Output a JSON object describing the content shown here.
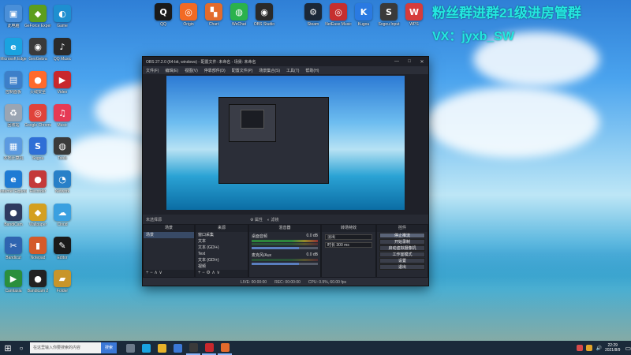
{
  "watermark": {
    "line1": "粉丝群进群21级进房管群",
    "line2": "VX：jyxb_SW"
  },
  "desktop_icons": [
    {
      "label": "此电脑",
      "icon": "computer-icon",
      "color": "#4a8fd8",
      "glyph": "▣"
    },
    {
      "label": "Microsoft Edge",
      "icon": "edge-icon",
      "color": "#1aa3e0",
      "glyph": "e"
    },
    {
      "label": "控制面板",
      "icon": "control-panel-icon",
      "color": "#3d7fc9",
      "glyph": "▤"
    },
    {
      "label": "回收站",
      "icon": "recycle-bin-icon",
      "color": "#9aa5b3",
      "glyph": "♻"
    },
    {
      "label": "本地计算机",
      "icon": "local-pc-icon",
      "color": "#5c9ae0",
      "glyph": "▦"
    },
    {
      "label": "Internet Explorer",
      "icon": "ie-icon",
      "color": "#1e7bd4",
      "glyph": "e"
    },
    {
      "label": "BandiCam",
      "icon": "bandicam-icon",
      "color": "#2e3a60",
      "glyph": "●"
    },
    {
      "label": "Bandicut",
      "icon": "bandicut-icon",
      "color": "#2f64b0",
      "glyph": "✂"
    },
    {
      "label": "Camtasia",
      "icon": "camtasia-icon",
      "color": "#2a8f3c",
      "glyph": "▶"
    },
    {
      "label": "GeForce Experience",
      "icon": "geforce-icon",
      "color": "#5c9e1e",
      "glyph": "◆"
    },
    {
      "label": "GeoGebra",
      "icon": "geogebra-icon",
      "color": "#3a3a3a",
      "glyph": "◉"
    },
    {
      "label": "火绒安全",
      "icon": "huorong-icon",
      "color": "#ff6a2c",
      "glyph": "●"
    },
    {
      "label": "Google Chrome",
      "icon": "chrome-icon",
      "color": "#e0433b",
      "glyph": "◎"
    },
    {
      "label": "Sogou",
      "icon": "sogou-icon",
      "color": "#2f6fd6",
      "glyph": "S"
    },
    {
      "label": "Recorder",
      "icon": "recorder-icon",
      "color": "#c43a3a",
      "glyph": "●"
    },
    {
      "label": "Wallpaper",
      "icon": "wallpaper-icon",
      "color": "#d4a020",
      "glyph": "◆"
    },
    {
      "label": "Notepad",
      "icon": "notepad-icon",
      "color": "#d45a2a",
      "glyph": "▮"
    },
    {
      "label": "Bandicam 2",
      "icon": "bandicam2-icon",
      "color": "#222222",
      "glyph": "●"
    },
    {
      "label": "Game",
      "icon": "game-icon",
      "color": "#1e8fd0",
      "glyph": "◐"
    },
    {
      "label": "QQ Music",
      "icon": "qqmusic-icon",
      "color": "#2a2a2a",
      "glyph": "♪"
    },
    {
      "label": "Video",
      "icon": "video-icon",
      "color": "#c8282d",
      "glyph": "▶"
    },
    {
      "label": "Music",
      "icon": "music-icon",
      "color": "#e63a55",
      "glyph": "♫"
    },
    {
      "label": "Tools",
      "icon": "tools-icon",
      "color": "#3a3a3a",
      "glyph": "◍"
    },
    {
      "label": "Network",
      "icon": "network-icon",
      "color": "#2880c8",
      "glyph": "◔"
    },
    {
      "label": "Cloud",
      "icon": "cloud-icon",
      "color": "#3aa0e0",
      "glyph": "☁"
    },
    {
      "label": "Editor",
      "icon": "editor-icon",
      "color": "#1a1a1a",
      "glyph": "✎"
    },
    {
      "label": "Folder",
      "icon": "folder-icon",
      "color": "#c8952a",
      "glyph": "▰"
    }
  ],
  "top_icons": [
    {
      "label": "QQ",
      "icon": "qq-icon",
      "color": "#1a1a1a",
      "glyph": "Q"
    },
    {
      "label": "Origin",
      "icon": "origin-icon",
      "color": "#f26a24",
      "glyph": "◎"
    },
    {
      "label": "Chart",
      "icon": "chart-app-icon",
      "color": "#e36b2c",
      "glyph": "▚"
    },
    {
      "label": "WeChat",
      "icon": "wechat-icon",
      "color": "#2bb24c",
      "glyph": "◍"
    },
    {
      "label": "OBS Studio",
      "icon": "obs-icon",
      "color": "#2a2a2a",
      "glyph": "◉"
    },
    {
      "label": "Steam",
      "icon": "steam-icon",
      "color": "#1b2838",
      "glyph": "⚙"
    },
    {
      "label": "NetEase Music",
      "icon": "netease-icon",
      "color": "#c62f2f",
      "glyph": "◎"
    },
    {
      "label": "Kugou",
      "icon": "kugou-icon",
      "color": "#2a7ae2",
      "glyph": "K"
    },
    {
      "label": "Sogou Input",
      "icon": "sogou-input-icon",
      "color": "#3a3a3a",
      "glyph": "S"
    },
    {
      "label": "WPS",
      "icon": "wps-icon",
      "color": "#d63c3c",
      "glyph": "W"
    }
  ],
  "obs": {
    "title": "OBS 27.2.0 (64-bit, windows) - 配置文件: 未命名 - 场景: 未命名",
    "menu": [
      "文件(F)",
      "编辑(E)",
      "视图(V)",
      "停靠部件(D)",
      "配置文件(P)",
      "场景集合(S)",
      "工具(T)",
      "帮助(H)"
    ],
    "source_bar": "未选择源",
    "source_bar_buttons": [
      "属性",
      "滤镜"
    ],
    "docks": {
      "scenes": {
        "title": "场景",
        "items": [
          "场景"
        ],
        "footer": "+ − ∧ ∨"
      },
      "sources": {
        "title": "来源",
        "items": [
          "窗口采集",
          "文本",
          "文本 (GDI+)",
          "Text",
          "文本 (GDI+)",
          "视频"
        ],
        "footer": "+ − ⚙ ∧ ∨"
      },
      "mixer": {
        "title": "混音器",
        "channels": [
          {
            "name": "桌面音频",
            "level": "0.0 dB",
            "vol": 0.72
          },
          {
            "name": "麦克风/Aux",
            "level": "0.0 dB",
            "vol": 0.72
          }
        ]
      },
      "transitions": {
        "title": "转场特效",
        "transition": "淡出",
        "duration_label": "时长",
        "duration": "300 ms"
      },
      "controls": {
        "title": "控件",
        "buttons": [
          "停止推流",
          "开始录制",
          "启动虚拟摄像机",
          "工作室模式",
          "设置",
          "退出"
        ]
      }
    },
    "status": [
      "LIVE: 00:00:00",
      "REC: 00:00:00",
      "CPU: 0.9%, 60.00 fps"
    ]
  },
  "taskbar": {
    "search_placeholder": "在这里输入你要搜索的内容",
    "search_button": "搜索",
    "time": "22:29",
    "date": "2021/8/9",
    "apps": [
      {
        "icon": "task-view-icon",
        "color": "#6c7a8a",
        "running": false
      },
      {
        "icon": "edge-taskbar-icon",
        "color": "#1aa3e0",
        "running": false
      },
      {
        "icon": "explorer-taskbar-icon",
        "color": "#e8b32a",
        "running": false
      },
      {
        "icon": "store-taskbar-icon",
        "color": "#3b78d6",
        "running": false
      },
      {
        "icon": "obs-taskbar-icon",
        "color": "#3a3a3a",
        "running": true
      },
      {
        "icon": "video-taskbar-icon",
        "color": "#c8282d",
        "running": true
      },
      {
        "icon": "chart-taskbar-icon",
        "color": "#e36b2c",
        "running": true
      }
    ]
  }
}
